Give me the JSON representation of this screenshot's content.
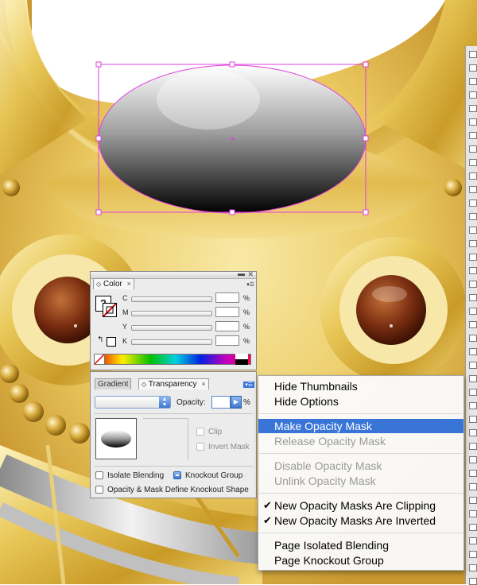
{
  "color_panel": {
    "tab_label": "Color",
    "close_glyph": "×",
    "channels": [
      {
        "label": "C",
        "value": "",
        "unit": "%"
      },
      {
        "label": "M",
        "value": "",
        "unit": "%"
      },
      {
        "label": "Y",
        "value": "",
        "unit": "%"
      },
      {
        "label": "K",
        "value": "",
        "unit": "%"
      }
    ],
    "unknown_color_glyph": "?"
  },
  "transparency_panel": {
    "tabs": [
      {
        "label": "Gradient"
      },
      {
        "label": "Transparency",
        "close_glyph": "×"
      }
    ],
    "blend_mode_value": "",
    "opacity_label": "Opacity:",
    "opacity_value": "",
    "opacity_unit": "%",
    "clip_label": "Clip",
    "invert_mask_label": "Invert Mask",
    "isolate_blending_label": "Isolate Blending",
    "knockout_group_label": "Knockout Group",
    "opacity_mask_knockout_label": "Opacity & Mask Define Knockout Shape"
  },
  "context_menu": {
    "groups": [
      [
        {
          "label": "Hide Thumbnails",
          "enabled": true
        },
        {
          "label": "Hide Options",
          "enabled": true
        }
      ],
      [
        {
          "label": "Make Opacity Mask",
          "enabled": true,
          "highlighted": true
        },
        {
          "label": "Release Opacity Mask",
          "enabled": false
        }
      ],
      [
        {
          "label": "Disable Opacity Mask",
          "enabled": false
        },
        {
          "label": "Unlink Opacity Mask",
          "enabled": false
        }
      ],
      [
        {
          "label": "New Opacity Masks Are Clipping",
          "enabled": true,
          "checked": true
        },
        {
          "label": "New Opacity Masks Are Inverted",
          "enabled": true,
          "checked": true
        }
      ],
      [
        {
          "label": "Page Isolated Blending",
          "enabled": true
        },
        {
          "label": "Page Knockout Group",
          "enabled": true
        }
      ]
    ]
  },
  "colors": {
    "selection": "#e040e0",
    "menu_highlight": "#3875d7",
    "gold_light": "#f6e28c",
    "gold_dark": "#b8860b"
  }
}
